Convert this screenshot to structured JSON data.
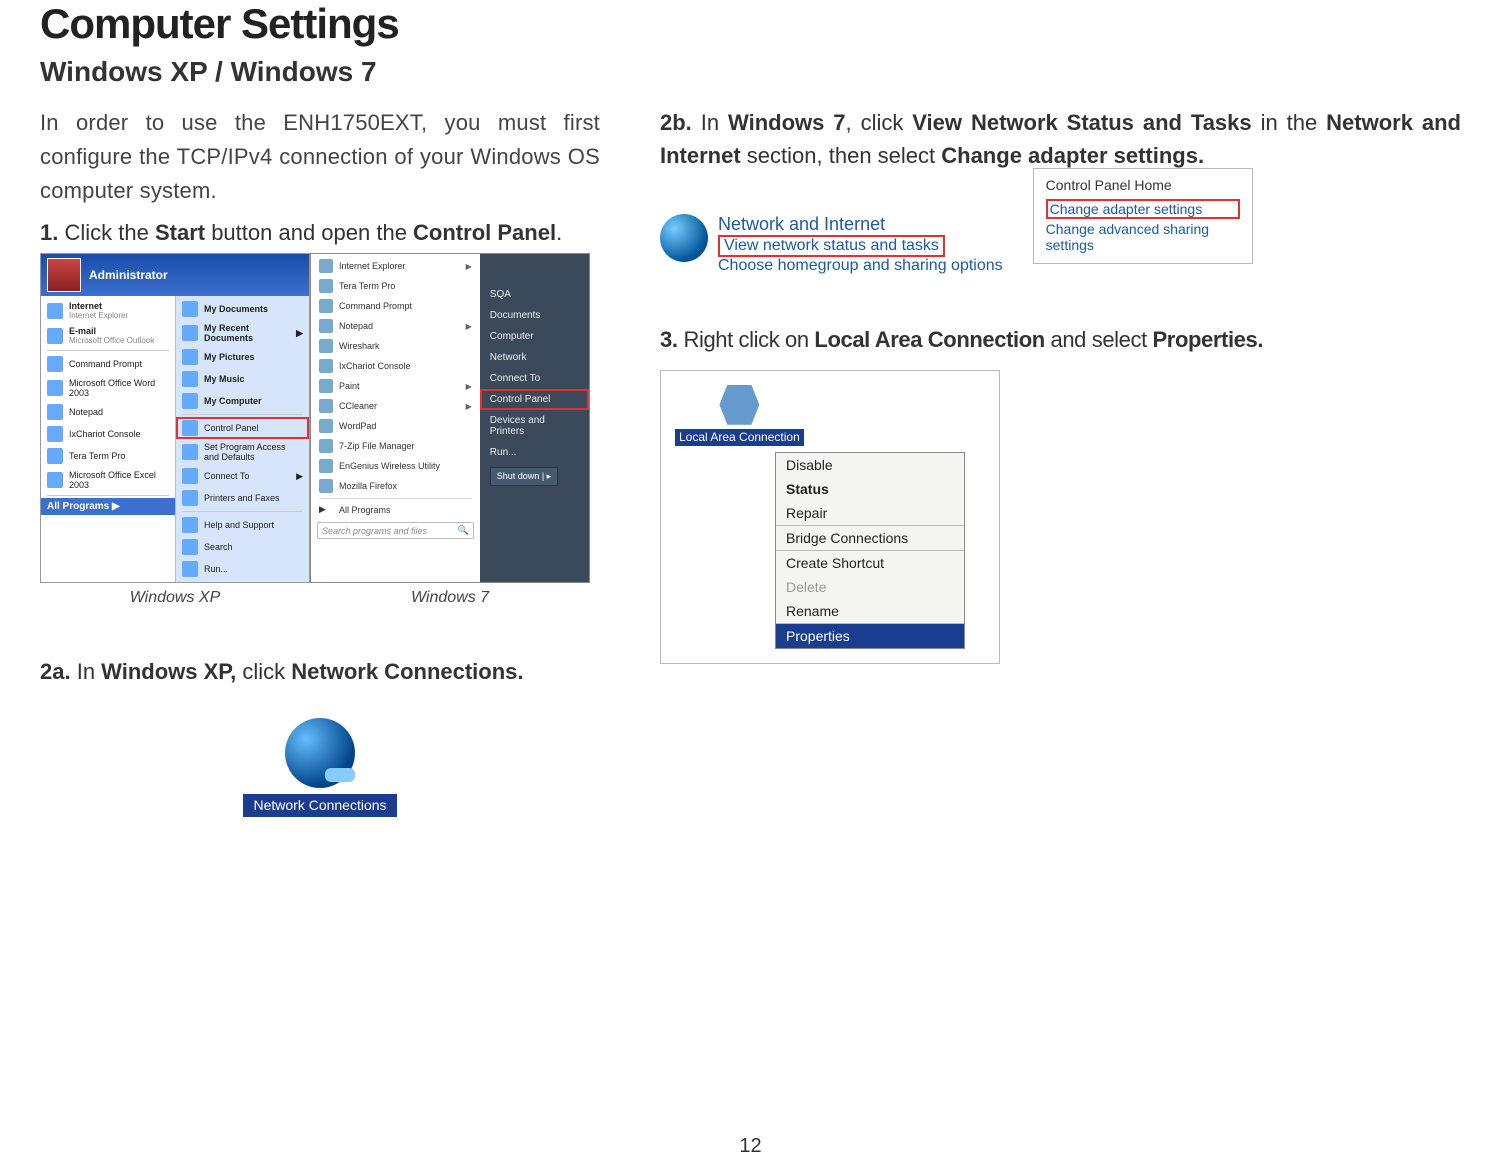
{
  "title": "Computer Settings",
  "subtitle": "Windows XP / Windows 7",
  "intro": "In order to use the ENH1750EXT, you must first configure the TCP/IPv4 connection of your Windows OS computer system.",
  "step1": {
    "num": "1.",
    "pre": " Click the ",
    "b1": "Start",
    "mid": " button and open the ",
    "b2": "Control Panel",
    "post": "."
  },
  "captions": {
    "xp": "Windows XP",
    "w7": "Windows 7"
  },
  "step2a": {
    "num": "2a.",
    "pre": " In ",
    "b1": "Windows XP,",
    "mid": " click ",
    "b2": "Network Connections.",
    "post": ""
  },
  "netconn_label": "Network Connections",
  "step2b": {
    "num": "2b.",
    "pre": " In ",
    "b1": "Windows 7",
    "mid1": ", click ",
    "b2": "View Network Status and Tasks",
    "mid2": " in the ",
    "b3": "Network and Internet",
    "mid3": " section, then select ",
    "b4": "Change adapter settings.",
    "post": ""
  },
  "ni_box": {
    "title": "Network and Internet",
    "line_hl": "View network status and tasks",
    "line_sub": "Choose homegroup and sharing options"
  },
  "cp_side": {
    "header": "Control Panel Home",
    "link_hl": "Change adapter settings",
    "link2": "Change advanced sharing settings"
  },
  "step3": {
    "num": "3.",
    "pre": "  Right click on ",
    "b1": "Local Area Connection",
    "mid": " and select ",
    "b2": "Properties.",
    "post": ""
  },
  "lac_label": "Local Area Connection",
  "ctx": {
    "disable": "Disable",
    "status": "Status",
    "repair": "Repair",
    "bridge": "Bridge Connections",
    "shortcut": "Create Shortcut",
    "delete": "Delete",
    "rename": "Rename",
    "properties": "Properties"
  },
  "xp_menu": {
    "header": "Administrator",
    "left": [
      {
        "label": "Internet",
        "sub": "Internet Explorer"
      },
      {
        "label": "E-mail",
        "sub": "Microsoft Office Outlook"
      },
      {
        "label": "Command Prompt"
      },
      {
        "label": "Microsoft Office Word 2003"
      },
      {
        "label": "Notepad"
      },
      {
        "label": "IxChariot Console"
      },
      {
        "label": "Tera Term Pro"
      },
      {
        "label": "Microsoft Office Excel 2003"
      }
    ],
    "footer": "All Programs",
    "right": [
      {
        "label": "My Documents",
        "bold": true
      },
      {
        "label": "My Recent Documents",
        "bold": true,
        "arrow": true
      },
      {
        "label": "My Pictures",
        "bold": true
      },
      {
        "label": "My Music",
        "bold": true
      },
      {
        "label": "My Computer",
        "bold": true
      },
      {
        "label": "Control Panel",
        "hl": true
      },
      {
        "label": "Set Program Access and Defaults"
      },
      {
        "label": "Connect To",
        "arrow": true
      },
      {
        "label": "Printers and Faxes"
      },
      {
        "label": "Help and Support"
      },
      {
        "label": "Search"
      },
      {
        "label": "Run..."
      }
    ]
  },
  "w7_menu": {
    "left": [
      {
        "label": "Internet Explorer",
        "arrow": true
      },
      {
        "label": "Tera Term Pro"
      },
      {
        "label": "Command Prompt"
      },
      {
        "label": "Notepad",
        "arrow": true
      },
      {
        "label": "Wireshark"
      },
      {
        "label": "IxChariot Console"
      },
      {
        "label": "Paint",
        "arrow": true
      },
      {
        "label": "CCleaner",
        "arrow": true
      },
      {
        "label": "WordPad"
      },
      {
        "label": "7-Zip File Manager"
      },
      {
        "label": "EnGenius Wireless Utility"
      },
      {
        "label": "Mozilla Firefox"
      }
    ],
    "all_programs": "All Programs",
    "search_placeholder": "Search programs and files",
    "shutdown": "Shut down",
    "right": [
      {
        "label": "SQA"
      },
      {
        "label": "Documents"
      },
      {
        "label": "Computer"
      },
      {
        "label": "Network"
      },
      {
        "label": "Connect To"
      },
      {
        "label": "Control Panel",
        "hl": true
      },
      {
        "label": "Devices and Printers"
      },
      {
        "label": "Run..."
      }
    ]
  },
  "page_number": "12"
}
